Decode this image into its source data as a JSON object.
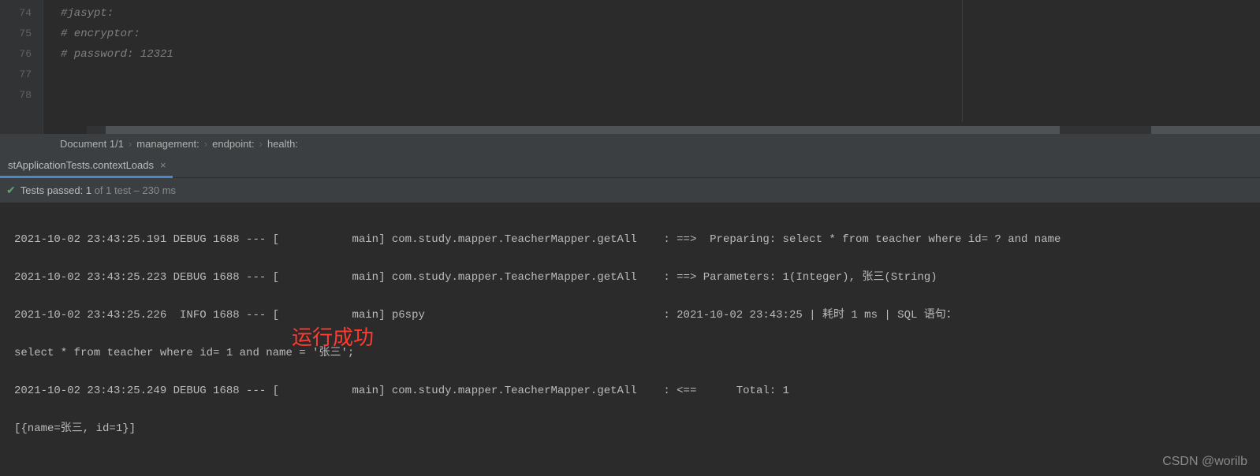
{
  "editor": {
    "lines": [
      {
        "num": "74",
        "text": "#jasypt:"
      },
      {
        "num": "75",
        "text": "#  encryptor:"
      },
      {
        "num": "76",
        "text": "#    password: 12321"
      },
      {
        "num": "77",
        "text": ""
      },
      {
        "num": "78",
        "text": ""
      }
    ]
  },
  "breadcrumb": {
    "items": [
      "Document 1/1",
      "management:",
      "endpoint:",
      "health:"
    ]
  },
  "tab": {
    "label": "stApplicationTests.contextLoads",
    "close": "×"
  },
  "status": {
    "prefix": "Tests passed: ",
    "count": "1",
    "suffix": " of 1 test – 230 ms"
  },
  "console": {
    "lines": [
      "2021-10-02 23:43:25.191 DEBUG 1688 --- [           main] com.study.mapper.TeacherMapper.getAll    : ==>  Preparing: select * from teacher where id= ? and name",
      "2021-10-02 23:43:25.223 DEBUG 1688 --- [           main] com.study.mapper.TeacherMapper.getAll    : ==> Parameters: 1(Integer), 张三(String)",
      "2021-10-02 23:43:25.226  INFO 1688 --- [           main] p6spy                                    : 2021-10-02 23:43:25 | 耗时 1 ms | SQL 语句：",
      "select * from teacher where id= 1 and name = '张三';",
      "2021-10-02 23:43:25.249 DEBUG 1688 --- [           main] com.study.mapper.TeacherMapper.getAll    : <==      Total: 1",
      "[{name=张三, id=1}]"
    ]
  },
  "annotation": "运行成功",
  "watermark": "CSDN @worilb"
}
